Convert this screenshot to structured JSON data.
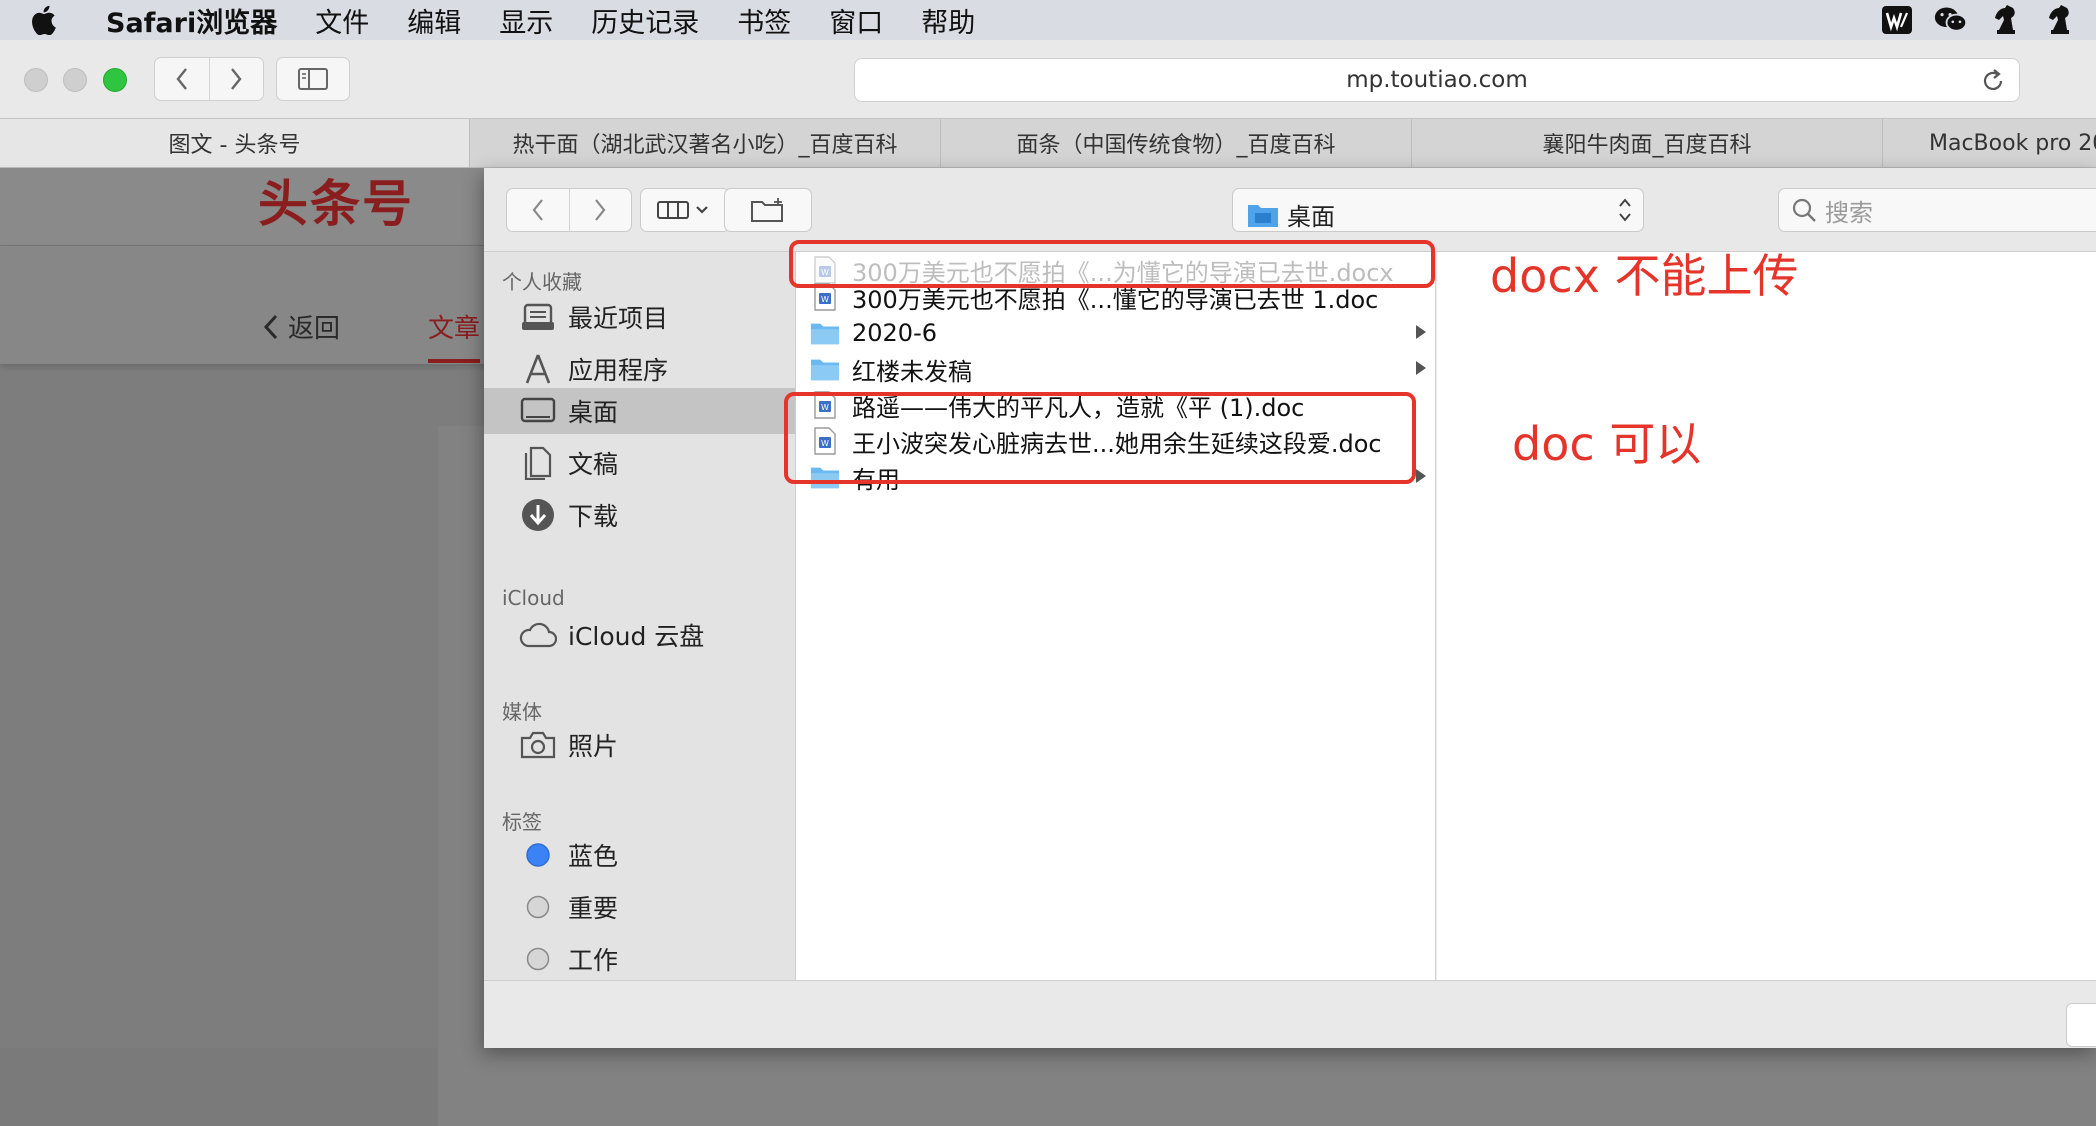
{
  "menubar": {
    "app_name": "Safari浏览器",
    "items": [
      "文件",
      "编辑",
      "显示",
      "历史记录",
      "书签",
      "窗口",
      "帮助"
    ],
    "tray_icons": [
      "wps-icon",
      "wechat-icon",
      "chess-knight-icon",
      "chess-knight-icon"
    ]
  },
  "browser": {
    "url": "mp.toutiao.com",
    "tabs": [
      {
        "label": "图文 - 头条号",
        "active": true
      },
      {
        "label": "热干面（湖北武汉著名小吃）_百度百科",
        "active": false
      },
      {
        "label": "面条（中国传统食物）_百度百科",
        "active": false
      },
      {
        "label": "襄阳牛肉面_百度百科",
        "active": false
      },
      {
        "label": "MacBook pro 20",
        "active": false
      }
    ]
  },
  "page": {
    "logo": "头条号",
    "back_label": "返回",
    "article_tab": "文章"
  },
  "dialog": {
    "location": "桌面",
    "search_placeholder": "搜索",
    "sidebar": {
      "favorites_header": "个人收藏",
      "favorites": [
        {
          "label": "最近项目",
          "icon": "recents-icon"
        },
        {
          "label": "应用程序",
          "icon": "applications-icon"
        },
        {
          "label": "桌面",
          "icon": "desktop-icon",
          "selected": true
        },
        {
          "label": "文稿",
          "icon": "documents-icon"
        },
        {
          "label": "下载",
          "icon": "downloads-icon"
        }
      ],
      "icloud_header": "iCloud",
      "icloud": [
        {
          "label": "iCloud 云盘",
          "icon": "cloud-icon"
        }
      ],
      "media_header": "媒体",
      "media": [
        {
          "label": "照片",
          "icon": "camera-icon"
        }
      ],
      "tags_header": "标签",
      "tags": [
        {
          "label": "蓝色",
          "color": "#3b82f6"
        },
        {
          "label": "重要",
          "color": "#d0d0d0"
        },
        {
          "label": "工作",
          "color": "#d0d0d0"
        }
      ]
    },
    "files": [
      {
        "name": "300万美元也不愿拍《...为懂它的导演已去世.docx",
        "type": "word",
        "disabled": true
      },
      {
        "name": "300万美元也不愿拍《...懂它的导演已去世 1.doc",
        "type": "word",
        "disabled": false
      },
      {
        "name": "2020-6",
        "type": "folder",
        "disabled": false
      },
      {
        "name": "红楼未发稿",
        "type": "folder",
        "disabled": false
      },
      {
        "name": "路遥——伟大的平凡人，造就《平 (1).doc",
        "type": "word",
        "disabled": false
      },
      {
        "name": "王小波突发心脏病去世...她用余生延续这段爱.doc",
        "type": "word",
        "disabled": false
      },
      {
        "name": "有用",
        "type": "folder",
        "disabled": false
      }
    ]
  },
  "annotations": {
    "note1": "docx 不能上传",
    "note2": "doc 可以",
    "color": "#e5342a"
  }
}
